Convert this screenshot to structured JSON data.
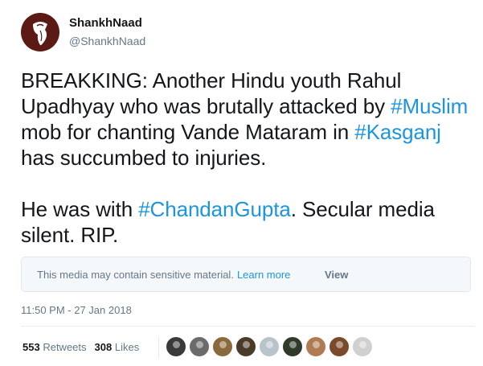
{
  "tweet": {
    "user": {
      "name": "ShankhNaad",
      "handle": "@ShankhNaad",
      "avatar_icon": "conch-shell-icon"
    },
    "paragraphs": [
      [
        {
          "text": "BREAKKING: Another Hindu youth Rahul Upadhyay who was brutally attacked by ",
          "link": false
        },
        {
          "text": "#Muslim",
          "link": true
        },
        {
          "text": " mob for chanting Vande Mataram in ",
          "link": false
        },
        {
          "text": "#Kasganj",
          "link": true
        },
        {
          "text": " has succumbed to injuries.",
          "link": false
        }
      ],
      [
        {
          "text": "He was with ",
          "link": false
        },
        {
          "text": "#ChandanGupta",
          "link": true
        },
        {
          "text": ". Secular media silent. RIP.",
          "link": false
        }
      ]
    ],
    "sensitive_notice": {
      "message": "This media may contain sensitive material.",
      "learn_more": "Learn more",
      "view_label": "View"
    },
    "timestamp": "11:50 PM - 27 Jan 2018",
    "stats": {
      "retweets_count": "553",
      "retweets_label": "Retweets",
      "likes_count": "308",
      "likes_label": "Likes"
    },
    "likers": [
      {
        "color": "#3a3a3a"
      },
      {
        "color": "#6b6b6b"
      },
      {
        "color": "#8a6a3c"
      },
      {
        "color": "#4a3a2a"
      },
      {
        "color": "#b8c4cc"
      },
      {
        "color": "#2f3a2a"
      },
      {
        "color": "#b07a52"
      },
      {
        "color": "#7a4a2a"
      },
      {
        "color": "#d0d0d0"
      }
    ]
  }
}
